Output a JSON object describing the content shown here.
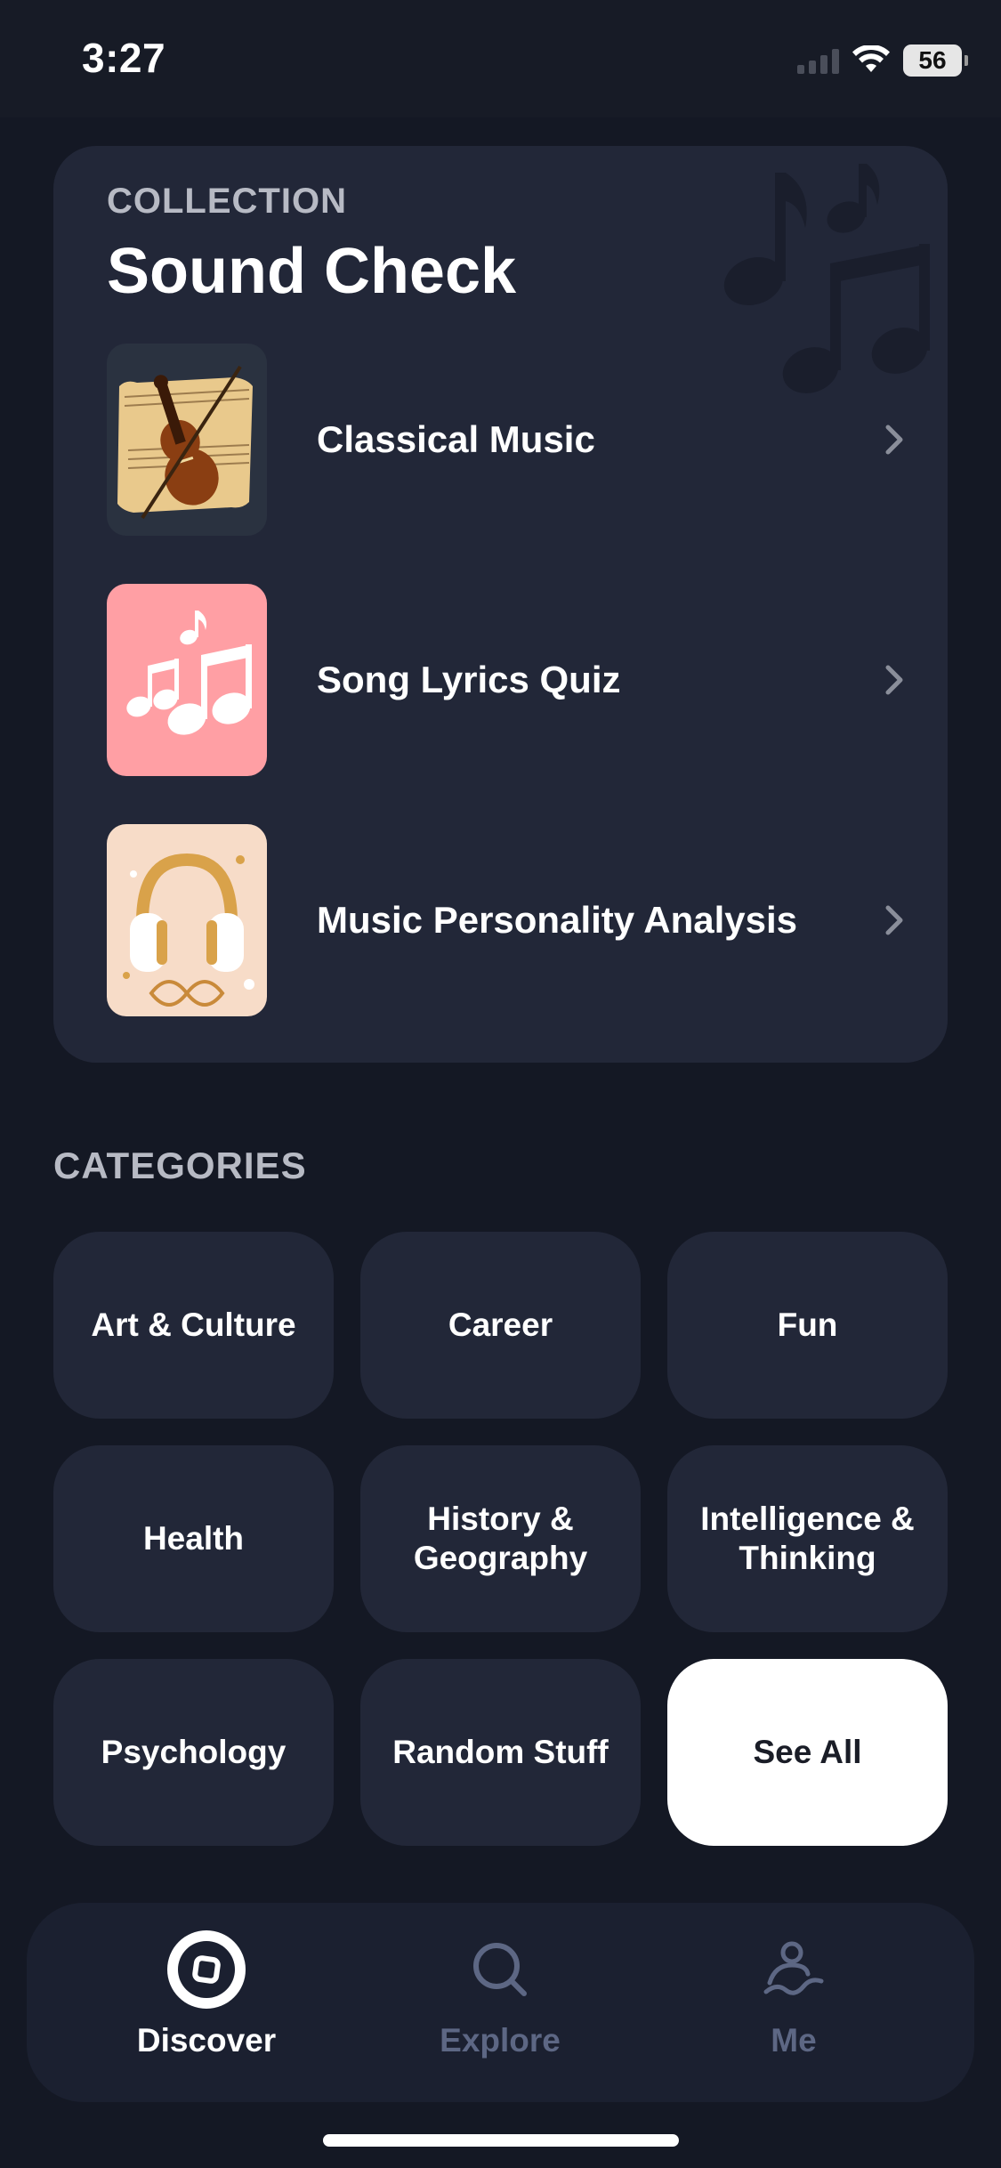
{
  "status_bar": {
    "time": "3:27",
    "battery": "56"
  },
  "collection": {
    "eyebrow": "COLLECTION",
    "title": "Sound Check",
    "items": [
      {
        "label": "Classical Music",
        "icon": "violin-thumbnail"
      },
      {
        "label": "Song Lyrics Quiz",
        "icon": "music-notes-thumbnail"
      },
      {
        "label": "Music Personality Analysis",
        "icon": "headphones-thumbnail"
      }
    ]
  },
  "categories": {
    "heading": "CATEGORIES",
    "items": [
      "Art & Culture",
      "Career",
      "Fun",
      "Health",
      "History & Geography",
      "Intelligence & Thinking",
      "Psychology",
      "Random Stuff"
    ],
    "see_all": "See All"
  },
  "tab_bar": {
    "tabs": [
      {
        "label": "Discover",
        "icon": "compass-icon",
        "active": true
      },
      {
        "label": "Explore",
        "icon": "search-icon",
        "active": false
      },
      {
        "label": "Me",
        "icon": "profile-icon",
        "active": false
      }
    ],
    "active_color": "#ffffff",
    "inactive_color": "#5d6784"
  },
  "colors": {
    "background": "#141824",
    "card": "#222738",
    "see_all_bg": "#ffffff",
    "pink_thumb": "#ff9fa4"
  }
}
